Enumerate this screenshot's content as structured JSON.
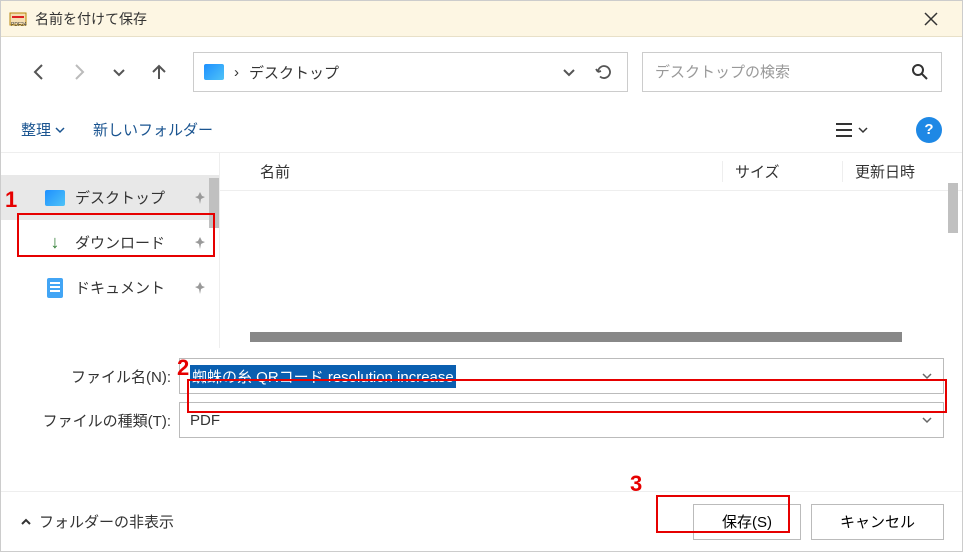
{
  "titlebar": {
    "title": "名前を付けて保存"
  },
  "nav": {},
  "address": {
    "crumb_sep": "›",
    "location": "デスクトップ"
  },
  "search": {
    "placeholder": "デスクトップの検索"
  },
  "toolbar": {
    "organize": "整理",
    "new_folder": "新しいフォルダー",
    "help": "?"
  },
  "sidebar": {
    "items": [
      {
        "label": "デスクトップ"
      },
      {
        "label": "ダウンロード"
      },
      {
        "label": "ドキュメント"
      }
    ]
  },
  "columns": {
    "name": "名前",
    "size": "サイズ",
    "date": "更新日時"
  },
  "form": {
    "filename_label": "ファイル名(N):",
    "filename_value": "蜘蛛の糸 QRコード resolution increase",
    "filetype_label": "ファイルの種類(T):",
    "filetype_value": "PDF"
  },
  "footer": {
    "hide_folders": "フォルダーの非表示",
    "save": "保存(S)",
    "cancel": "キャンセル"
  },
  "annotations": {
    "a1": "1",
    "a2": "2",
    "a3": "3"
  }
}
